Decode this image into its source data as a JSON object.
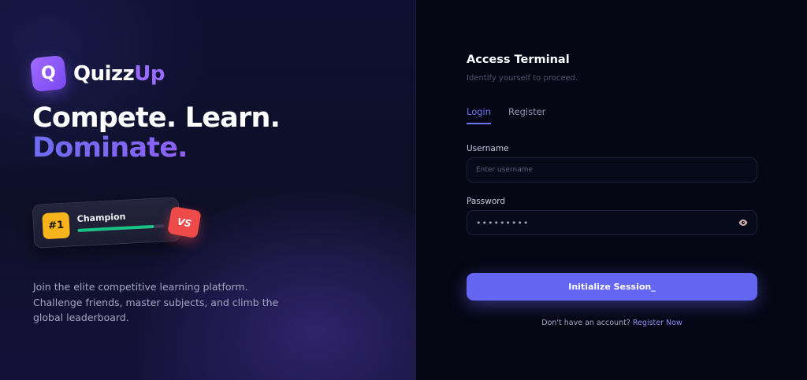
{
  "brand": {
    "badge_letter": "Q",
    "name_part1": "Quizz",
    "name_part2": "Up",
    "accent_color": "#9b6bff"
  },
  "hero": {
    "line1": "Compete. Learn.",
    "line2": "Dominate."
  },
  "card": {
    "rank": "#1",
    "label": "Champion",
    "progress": 0.88,
    "vs_label": "VS"
  },
  "description": "Join the elite competitive learning platform. Challenge friends, master subjects, and climb the global leaderboard.",
  "form": {
    "title": "Access Terminal",
    "subtitle": "Identify yourself to proceed.",
    "tabs": [
      {
        "label": "Login",
        "active": true
      },
      {
        "label": "Register",
        "active": false
      }
    ],
    "username": {
      "label": "Username",
      "placeholder": "Enter username",
      "value": ""
    },
    "password": {
      "label": "Password",
      "value": "•••••••••",
      "toggle_icon": "eye-icon"
    },
    "submit_label": "Initialize Session_",
    "footer_text": "Don't have an account?",
    "footer_link": "Register Now",
    "button_color": "#6366f1"
  }
}
